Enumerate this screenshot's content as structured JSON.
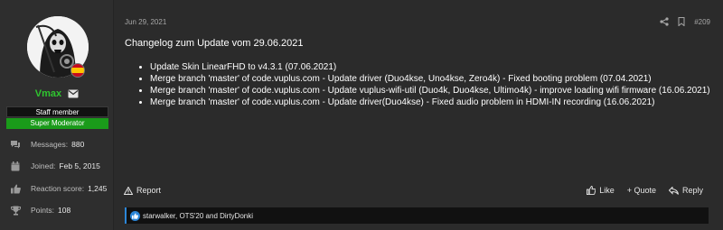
{
  "user": {
    "name": "Vmax",
    "staff_label": "Staff member",
    "role_label": "Super Moderator",
    "stats": [
      {
        "label": "Messages:",
        "value": "880",
        "icon": "messages-icon"
      },
      {
        "label": "Joined:",
        "value": "Feb 5, 2015",
        "icon": "calendar-icon"
      },
      {
        "label": "Reaction score:",
        "value": "1,245",
        "icon": "thumbs-up-icon"
      },
      {
        "label": "Points:",
        "value": "108",
        "icon": "trophy-icon"
      }
    ]
  },
  "post": {
    "date": "Jun 29, 2021",
    "number": "#209",
    "title": "Changelog zum Update vom 29.06.2021",
    "changes": [
      "Update Skin LinearFHD to v4.3.1 (07.06.2021)",
      "Merge branch 'master' of code.vuplus.com - Update driver (Duo4kse, Uno4kse, Zero4k) - Fixed booting problem (07.04.2021)",
      "Merge branch 'master' of code.vuplus.com - Update vuplus-wifi-util (Duo4k, Duo4kse, Ultimo4k) - improve loading wifi firmware (16.06.2021)",
      "Merge branch 'master' of code.vuplus.com - Update driver(Duo4kse) - Fixed audio problem in HDMI-IN recording (16.06.2021)"
    ]
  },
  "actions": {
    "report": "Report",
    "like": "Like",
    "quote": "+ Quote",
    "reply": "Reply"
  },
  "reactions": {
    "text": "starwalker, OTS'20 and DirtyDonki"
  },
  "colors": {
    "username": "#2fc52f",
    "moderator_badge": "#1a9b1a",
    "reaction_accent": "#2c86d8",
    "background": "#2b2b2b"
  }
}
